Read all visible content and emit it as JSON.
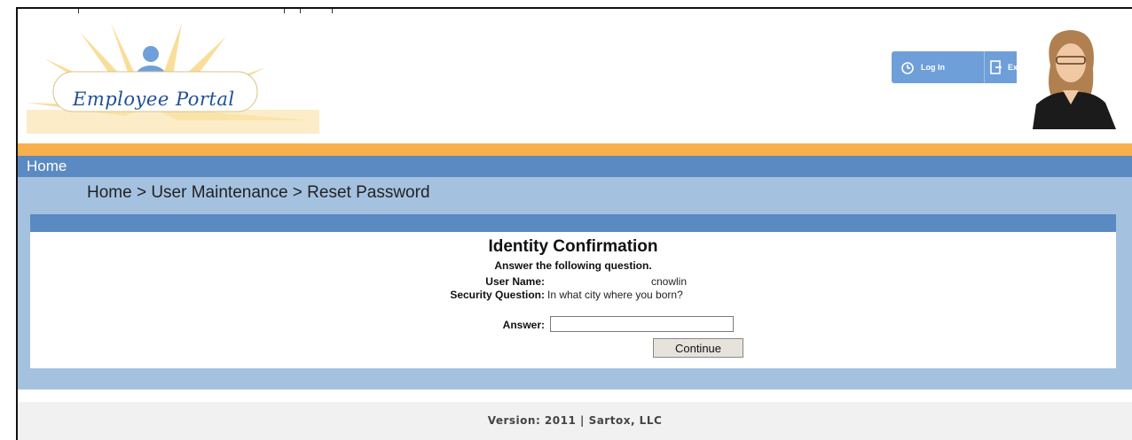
{
  "header": {
    "logo_text": "Employee Portal",
    "login_label": "Log In",
    "exit_label": "Exit"
  },
  "nav": {
    "home_label": "Home"
  },
  "breadcrumb": "Home > User Maintenance > Reset Password",
  "form": {
    "title": "Identity Confirmation",
    "subtitle": "Answer the following question.",
    "username_label": "User Name:",
    "username_value": "cnowlin",
    "question_label": "Security Question:",
    "question_value": "In what city where you born?",
    "answer_label": "Answer:",
    "answer_value": "",
    "continue_label": "Continue"
  },
  "footer": {
    "text": "Version: 2011 | Sartox, LLC"
  },
  "colors": {
    "orange_bar": "#f8b04c",
    "nav_blue": "#5b8ac2",
    "light_blue": "#a4c2e0",
    "header_button_blue": "#6f9fd8"
  }
}
